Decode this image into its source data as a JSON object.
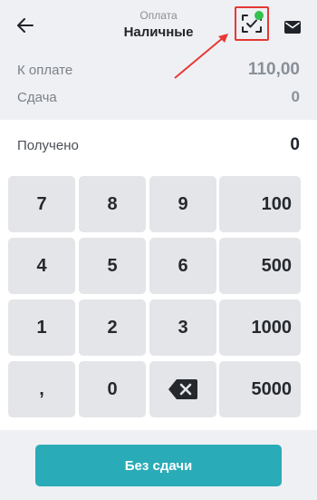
{
  "header": {
    "subtitle": "Оплата",
    "title": "Наличные",
    "icons": {
      "back": "arrow-left-icon",
      "scan": "scan-check-icon",
      "mail": "envelope-icon"
    },
    "status_color": "#33c24d",
    "highlight_color": "#e53935"
  },
  "summary": {
    "due_label": "К оплате",
    "due_value": "110,00",
    "change_label": "Сдача",
    "change_value": "0"
  },
  "received": {
    "label": "Получено",
    "value": "0"
  },
  "keypad": {
    "k7": "7",
    "k8": "8",
    "k9": "9",
    "q100": "100",
    "k4": "4",
    "k5": "5",
    "k6": "6",
    "q500": "500",
    "k1": "1",
    "k2": "2",
    "k3": "3",
    "q1000": "1000",
    "comma": ",",
    "k0": "0",
    "q5000": "5000",
    "backspace_icon": "backspace-icon"
  },
  "footer": {
    "no_change_label": "Без сдачи",
    "accent_color": "#2aabb8"
  }
}
